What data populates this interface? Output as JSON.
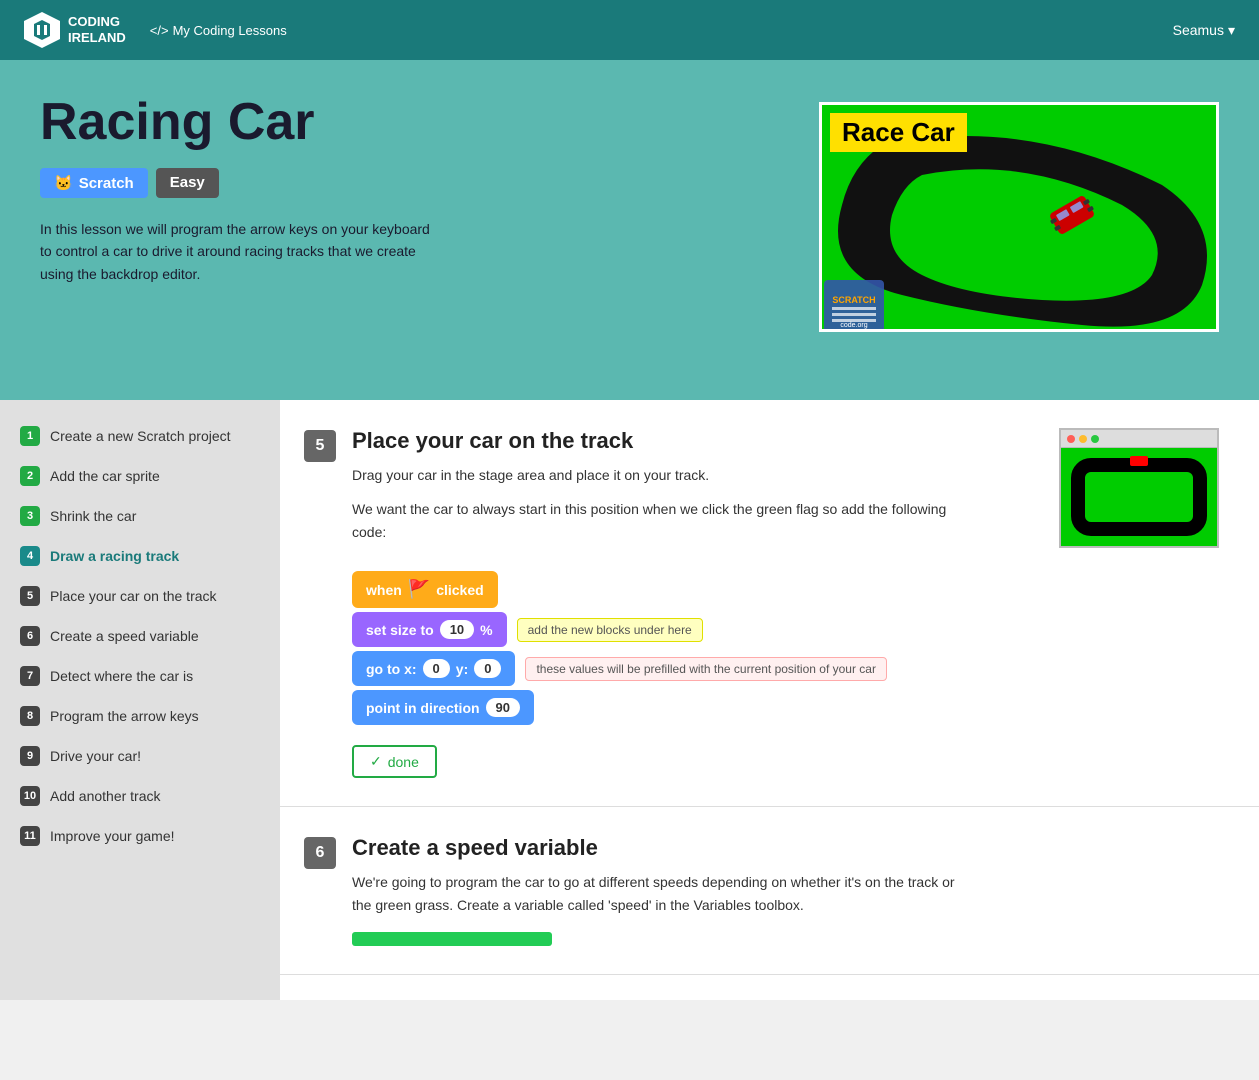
{
  "header": {
    "logo_line1": "CODING",
    "logo_line2": "IRELAND",
    "nav_label": "My Coding Lessons",
    "user": "Seamus",
    "user_dropdown": "▾"
  },
  "hero": {
    "title": "Racing Car",
    "badge_scratch": "Scratch",
    "badge_easy": "Easy",
    "description": "In this lesson we will program the arrow keys on your keyboard to control a car to drive it around racing tracks that we create using the backdrop editor.",
    "image_title": "Race Car"
  },
  "sidebar": {
    "items": [
      {
        "num": "1",
        "label": "Create a new Scratch project",
        "style": "green"
      },
      {
        "num": "2",
        "label": "Add the car sprite",
        "style": "green"
      },
      {
        "num": "3",
        "label": "Shrink the car",
        "style": "green"
      },
      {
        "num": "4",
        "label": "Draw a racing track",
        "style": "teal"
      },
      {
        "num": "5",
        "label": "Place your car on the track",
        "style": "dark"
      },
      {
        "num": "6",
        "label": "Create a speed variable",
        "style": "dark"
      },
      {
        "num": "7",
        "label": "Detect where the car is",
        "style": "dark"
      },
      {
        "num": "8",
        "label": "Program the arrow keys",
        "style": "dark"
      },
      {
        "num": "9",
        "label": "Drive your car!",
        "style": "dark"
      },
      {
        "num": "10",
        "label": "Add another track",
        "style": "dark"
      },
      {
        "num": "11",
        "label": "Improve your game!",
        "style": "dark"
      }
    ]
  },
  "section5": {
    "num": "5",
    "title": "Place your car on the track",
    "desc1": "Drag your car in the stage area and place it on your track.",
    "desc2": "We want the car to always start in this position when we click the green flag so add the following code:",
    "blocks": {
      "when_clicked": "when",
      "clicked": "clicked",
      "set_size": "set size to",
      "size_val": "10",
      "size_pct": "%",
      "annotation1": "add the new blocks under here",
      "go_to": "go to x:",
      "x_val": "0",
      "y_label": "y:",
      "y_val": "0",
      "annotation2": "these values will be prefilled with the current position of your car",
      "point_dir": "point in direction",
      "dir_val": "90"
    },
    "done_label": "✓ done"
  },
  "section6": {
    "num": "6",
    "title": "Create a speed variable",
    "desc": "We're going to program the car to go at different speeds depending on whether it's on the track or the green grass. Create a variable called 'speed' in the Variables toolbox."
  }
}
